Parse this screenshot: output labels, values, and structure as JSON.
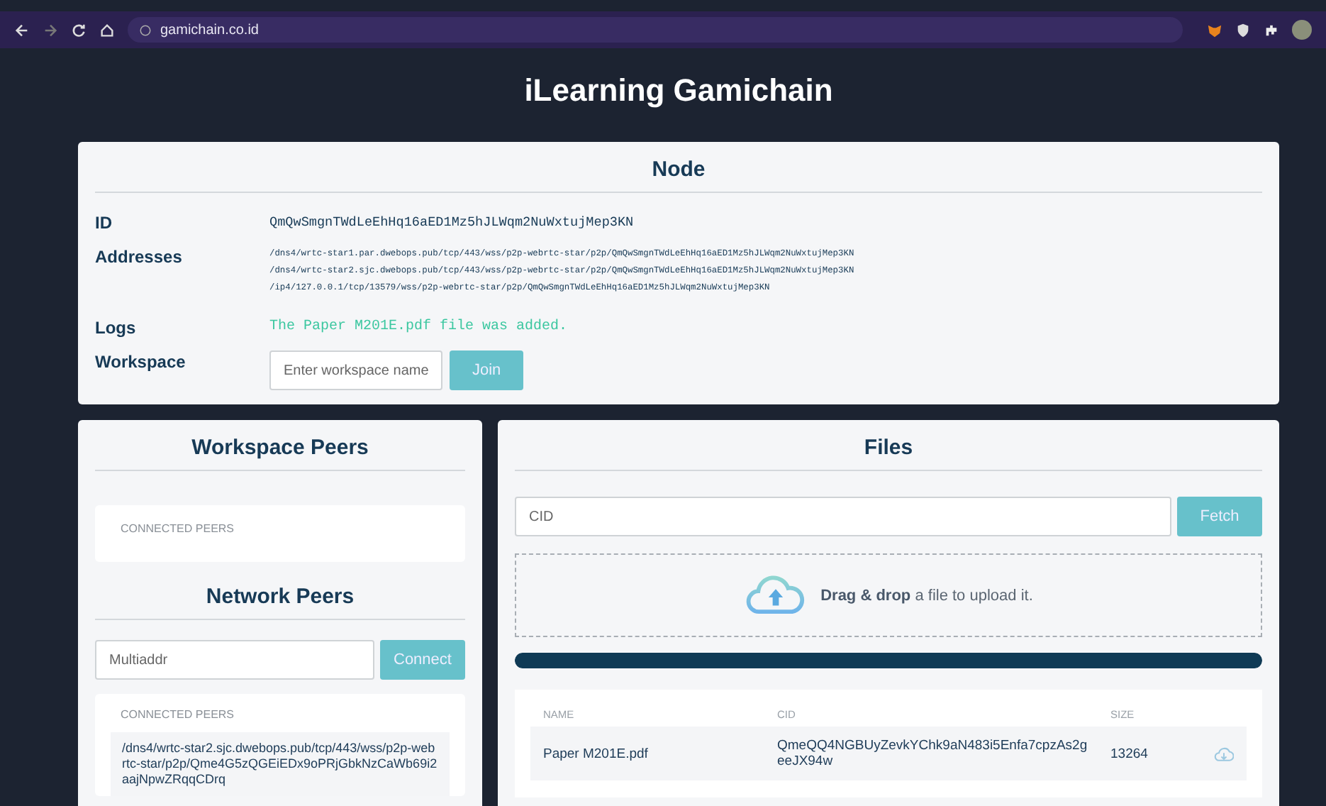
{
  "browser": {
    "url": "gamichain.co.id"
  },
  "title": "iLearning Gamichain",
  "node": {
    "heading": "Node",
    "id_label": "ID",
    "id": "QmQwSmgnTWdLeEhHq16aED1Mz5hJLWqm2NuWxtujMep3KN",
    "addresses_label": "Addresses",
    "addresses": [
      "/dns4/wrtc-star1.par.dwebops.pub/tcp/443/wss/p2p-webrtc-star/p2p/QmQwSmgnTWdLeEhHq16aED1Mz5hJLWqm2NuWxtujMep3KN",
      "/dns4/wrtc-star2.sjc.dwebops.pub/tcp/443/wss/p2p-webrtc-star/p2p/QmQwSmgnTWdLeEhHq16aED1Mz5hJLWqm2NuWxtujMep3KN",
      "/ip4/127.0.0.1/tcp/13579/wss/p2p-webrtc-star/p2p/QmQwSmgnTWdLeEhHq16aED1Mz5hJLWqm2NuWxtujMep3KN"
    ],
    "logs_label": "Logs",
    "log": "The Paper M201E.pdf file was added.",
    "workspace_label": "Workspace",
    "workspace_placeholder": "Enter workspace name",
    "join": "Join"
  },
  "workspace_peers": {
    "heading": "Workspace Peers",
    "connected_label": "CONNECTED PEERS"
  },
  "network_peers": {
    "heading": "Network Peers",
    "placeholder": "Multiaddr",
    "connect": "Connect",
    "connected_label": "CONNECTED PEERS",
    "peers": [
      "/dns4/wrtc-star2.sjc.dwebops.pub/tcp/443/wss/p2p-webrtc-star/p2p/Qme4G5zQGEiEDx9oPRjGbkNzCaWb69i2aajNpwZRqqCDrq"
    ]
  },
  "files": {
    "heading": "Files",
    "cid_placeholder": "CID",
    "fetch": "Fetch",
    "drop_bold": "Drag & drop",
    "drop_rest": "a file to upload it.",
    "progress": {
      "level": 1
    },
    "columns": [
      "NAME",
      "CID",
      "SIZE"
    ],
    "rows": [
      {
        "name": "Paper M201E.pdf",
        "cid": "QmeQQ4NGBUyZevkYChk9aN483i5Enfa7cpzAs2geeJX94w",
        "size": "13264"
      }
    ]
  }
}
